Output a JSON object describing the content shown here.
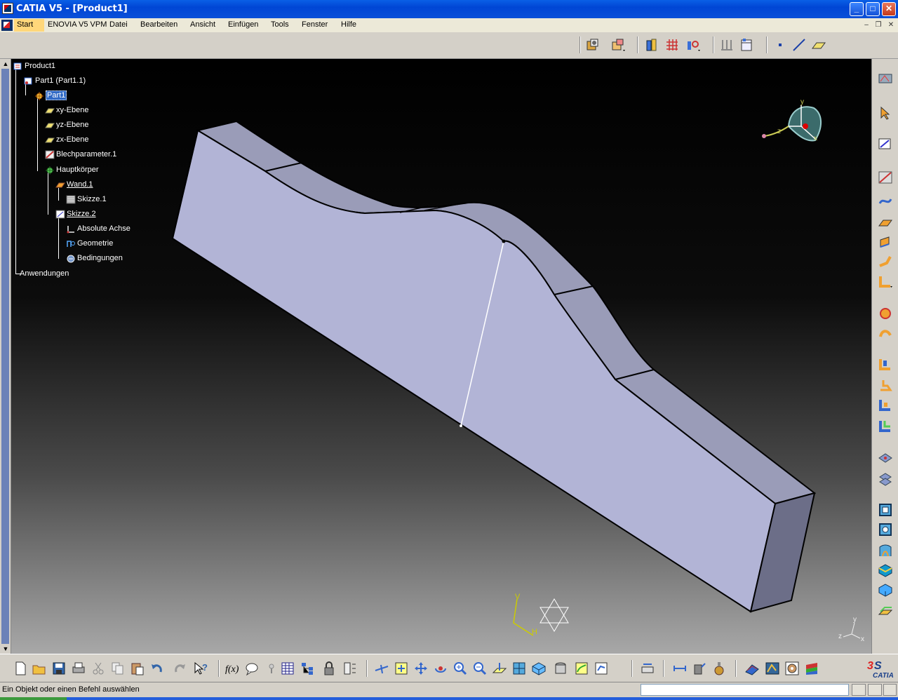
{
  "window": {
    "title": "CATIA V5 - [Product1]",
    "controls": {
      "minimize": "_",
      "maximize": "□",
      "close": "✕"
    }
  },
  "menubar": {
    "items": [
      {
        "label": "Start",
        "active": true
      },
      {
        "label": "ENOVIA V5 VPM"
      },
      {
        "label": "Datei"
      },
      {
        "label": "Bearbeiten"
      },
      {
        "label": "Ansicht"
      },
      {
        "label": "Einfügen"
      },
      {
        "label": "Tools"
      },
      {
        "label": "Fenster"
      },
      {
        "label": "Hilfe"
      }
    ],
    "mdi_controls": {
      "minimize": "–",
      "restore": "❐",
      "close": "✕"
    }
  },
  "tree": {
    "nodes": [
      {
        "label": "Product1",
        "icon": "product-icon"
      },
      {
        "label": "Part1 (Part1.1)",
        "icon": "part-instance-icon"
      },
      {
        "label": "Part1",
        "icon": "part-icon",
        "selected": true
      },
      {
        "label": "xy-Ebene",
        "icon": "plane-icon"
      },
      {
        "label": "yz-Ebene",
        "icon": "plane-icon"
      },
      {
        "label": "zx-Ebene",
        "icon": "plane-icon"
      },
      {
        "label": "Blechparameter.1",
        "icon": "sheetmetal-parameters-icon"
      },
      {
        "label": "Hauptkörper",
        "icon": "body-icon"
      },
      {
        "label": "Wand.1",
        "icon": "wall-icon"
      },
      {
        "label": "Skizze.1",
        "icon": "sketch-icon"
      },
      {
        "label": "Skizze.2",
        "icon": "sketch-icon"
      },
      {
        "label": "Absolute Achse",
        "icon": "absolute-axis-icon"
      },
      {
        "label": "Geometrie",
        "icon": "geometry-icon"
      },
      {
        "label": "Bedingungen",
        "icon": "constraints-icon"
      },
      {
        "label": "Anwendungen",
        "icon": "applications-icon"
      }
    ]
  },
  "compass": {
    "axis_x": "x",
    "axis_y": "y",
    "axis_z": "z"
  },
  "sketch_axis": {
    "v": "V",
    "h": "H"
  },
  "corner_axis": {
    "x": "x",
    "y": "y",
    "z": "z"
  },
  "status": {
    "message": "Ein Objekt oder einen Befehl auswählen",
    "command_input": ""
  },
  "branding": {
    "logo_text": "CATIA"
  },
  "colors": {
    "titlebar": "#0046d5",
    "part_face": "#b2b4d6",
    "part_side": "#9a9cb8",
    "part_end": "#6c6e88",
    "selection": "#316ac5"
  },
  "toolbars": {
    "top": [
      "assembly-catalog-icon",
      "product-structure-icon",
      "sheet-metal-parameters-icon",
      "recognize-icon",
      "view-icon",
      "grid-icon",
      "point-icon",
      "line-icon",
      "plane-icon"
    ],
    "right": [
      "workbench-icon",
      "select-icon",
      "sketcher-icon",
      "sheetmetal-params-icon",
      "wall-icon",
      "extrusion-icon",
      "flange-icon",
      "bend-icon",
      "unfold-icon",
      "fold-icon",
      "cut-icon",
      "hole-icon",
      "corner-icon",
      "chamfer-icon",
      "stamp-icon",
      "pattern-icon",
      "symmetry-icon",
      "view-front-icon",
      "view-back-icon",
      "surface-stamp-icon",
      "louver-icon",
      "bead-icon",
      "curve-stamp-icon"
    ],
    "bottom": [
      "new-icon",
      "open-icon",
      "save-icon",
      "print-icon",
      "cut-icon",
      "copy-icon",
      "paste-icon",
      "undo-icon",
      "redo-icon",
      "whats-this-icon",
      "formula-icon",
      "comment-icon",
      "knowledge-icon",
      "table-icon",
      "tree-icon",
      "lock-icon",
      "measure-icon",
      "fly-icon",
      "fit-all-icon",
      "pan-icon",
      "rotate-icon",
      "zoom-in-icon",
      "zoom-out-icon",
      "normal-view-icon",
      "multi-view-icon",
      "iso-view-icon",
      "render-icon",
      "hide-show-icon",
      "swap-icon",
      "measure-between-icon",
      "measure-item-icon",
      "measure-inertia-icon",
      "apply-material-icon",
      "photo-icon",
      "analysis-icon",
      "3d-icon"
    ]
  }
}
